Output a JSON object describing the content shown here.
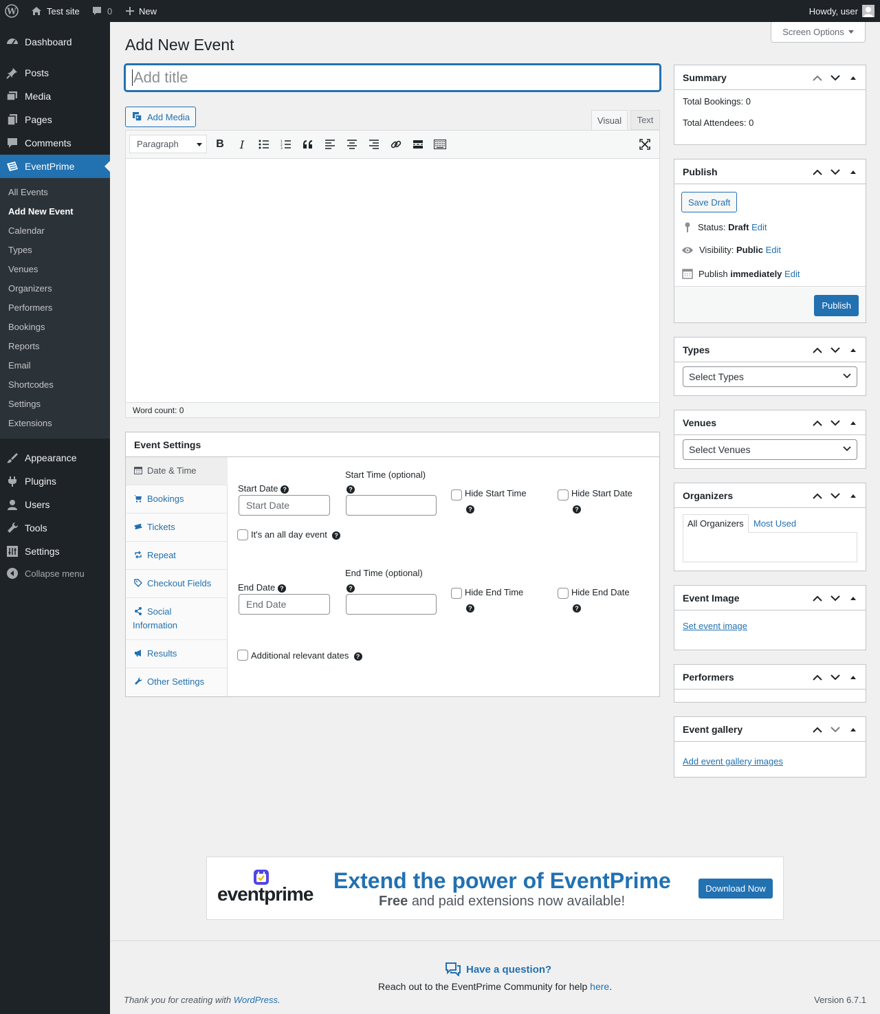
{
  "adminbar": {
    "site_name": "Test site",
    "comments_count": "0",
    "new_label": "New",
    "howdy": "Howdy, user"
  },
  "sidebar": {
    "top": [
      {
        "label": "Dashboard"
      },
      {
        "label": "Posts"
      },
      {
        "label": "Media"
      },
      {
        "label": "Pages"
      },
      {
        "label": "Comments"
      }
    ],
    "current": "EventPrime",
    "sub": [
      "All Events",
      "Add New Event",
      "Calendar",
      "Types",
      "Venues",
      "Organizers",
      "Performers",
      "Bookings",
      "Reports",
      "Email",
      "Shortcodes",
      "Settings",
      "Extensions"
    ],
    "bottom": [
      {
        "label": "Appearance"
      },
      {
        "label": "Plugins"
      },
      {
        "label": "Users"
      },
      {
        "label": "Tools"
      },
      {
        "label": "Settings"
      }
    ],
    "collapse": "Collapse menu"
  },
  "page": {
    "title": "Add New Event",
    "screen_options": "Screen Options"
  },
  "editor": {
    "title_placeholder": "Add title",
    "add_media": "Add Media",
    "tab_visual": "Visual",
    "tab_text": "Text",
    "format_select": "Paragraph",
    "word_count": "Word count: 0"
  },
  "event_settings": {
    "title": "Event Settings",
    "tabs": [
      "Date & Time",
      "Bookings",
      "Tickets",
      "Repeat",
      "Checkout Fields",
      "Social Information",
      "Results",
      "Other Settings"
    ],
    "start_date_label": "Start Date",
    "start_date_placeholder": "Start Date",
    "start_time_label": "Start Time (optional)",
    "hide_start_time": "Hide Start Time",
    "hide_start_date": "Hide Start Date",
    "all_day": "It's an all day event",
    "end_date_label": "End Date",
    "end_date_placeholder": "End Date",
    "end_time_label": "End Time (optional)",
    "hide_end_time": "Hide End Time",
    "hide_end_date": "Hide End Date",
    "additional_dates": "Additional relevant dates"
  },
  "summary": {
    "title": "Summary",
    "bookings": "Total Bookings: 0",
    "attendees": "Total Attendees: 0"
  },
  "publish": {
    "title": "Publish",
    "save_draft": "Save Draft",
    "status_label": "Status:",
    "status_value": "Draft",
    "visibility_label": "Visibility:",
    "visibility_value": "Public",
    "publish_label": "Publish",
    "publish_value": "immediately",
    "edit": "Edit",
    "publish_button": "Publish"
  },
  "types": {
    "title": "Types",
    "select": "Select Types"
  },
  "venues": {
    "title": "Venues",
    "select": "Select Venues"
  },
  "organizers": {
    "title": "Organizers",
    "tab_all": "All Organizers",
    "tab_used": "Most Used"
  },
  "event_image": {
    "title": "Event Image",
    "link": "Set event image"
  },
  "performers": {
    "title": "Performers"
  },
  "gallery": {
    "title": "Event gallery",
    "link": "Add event gallery images"
  },
  "banner": {
    "logo_text": "eventprime",
    "headline": "Extend the power of EventPrime",
    "sub_bold": "Free",
    "sub_rest": "and paid extensions now available!",
    "button": "Download Now"
  },
  "help": {
    "title": "Have a question?",
    "text": "Reach out to the EventPrime Community for help",
    "link": "here"
  },
  "footer": {
    "thanks": "Thank you for creating with",
    "wp_link": "WordPress",
    "version": "Version 6.7.1"
  },
  "colors": {
    "accent": "#2271b1",
    "menu_bg": "#1d2327",
    "current_bg": "#2271b1"
  }
}
